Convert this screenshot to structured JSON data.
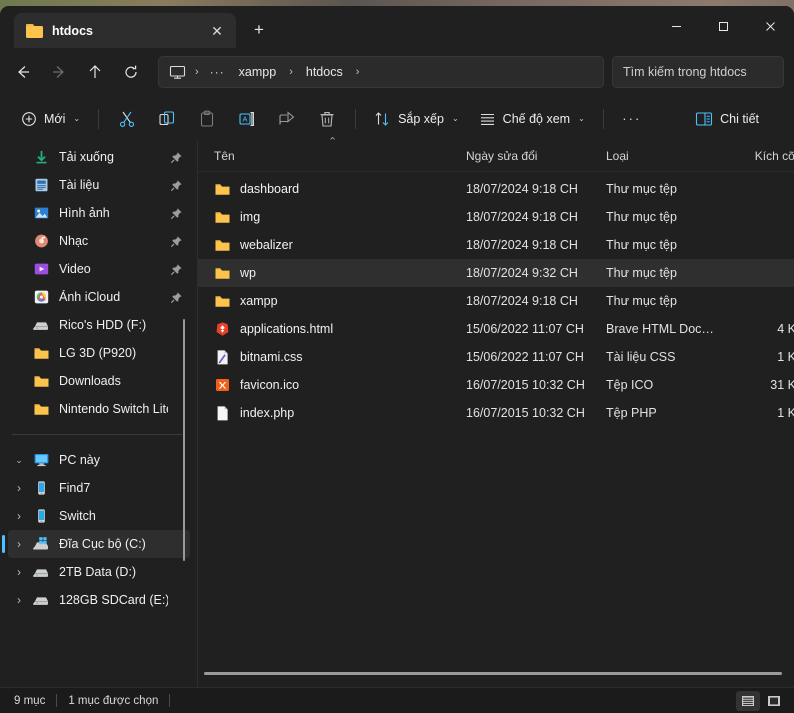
{
  "window": {
    "tab_title": "htdocs",
    "close_tab_label": "✕",
    "new_tab_label": "+",
    "minimize_label": "—",
    "maximize_label": "◻",
    "close_label": "✕"
  },
  "nav": {
    "back_label": "←",
    "forward_label": "→",
    "up_label": "↑",
    "refresh_label": "⟳",
    "breadcrumb": [
      {
        "label": "xampp"
      },
      {
        "label": "htdocs"
      }
    ],
    "breadcrumb_overflow": "···",
    "separator": "›",
    "search_placeholder": "Tìm kiếm trong htdocs"
  },
  "toolbar": {
    "new_label": "Mới",
    "cut_label": "Cắt",
    "copy_label": "Sao chép",
    "paste_label": "Dán",
    "rename_label": "Đổi tên",
    "share_label": "Chia sẻ",
    "delete_label": "Xóa",
    "sort_label": "Sắp xếp",
    "view_label": "Chế độ xem",
    "more_label": "···",
    "details_label": "Chi tiết",
    "chevron": "⌄",
    "accent_color": "#4cc2ff"
  },
  "sidebar": {
    "groups": [
      {
        "items": [
          {
            "label": "Tải xuống",
            "icon": "download-icon",
            "pinned": true,
            "expander": false,
            "selected": false
          },
          {
            "label": "Tài liệu",
            "icon": "documents-icon",
            "pinned": true,
            "expander": false,
            "selected": false
          },
          {
            "label": "Hình ảnh",
            "icon": "pictures-icon",
            "pinned": true,
            "expander": false,
            "selected": false
          },
          {
            "label": "Nhạc",
            "icon": "music-icon",
            "pinned": true,
            "expander": false,
            "selected": false
          },
          {
            "label": "Video",
            "icon": "video-icon",
            "pinned": true,
            "expander": false,
            "selected": false
          },
          {
            "label": "Ảnh iCloud",
            "icon": "icloud-photos-icon",
            "pinned": true,
            "expander": false,
            "selected": false
          },
          {
            "label": "Rico's HDD (F:)",
            "icon": "drive-icon",
            "pinned": false,
            "expander": false,
            "selected": false
          },
          {
            "label": "LG 3D (P920)",
            "icon": "folder-icon",
            "pinned": false,
            "expander": false,
            "selected": false
          },
          {
            "label": "Downloads",
            "icon": "folder-icon",
            "pinned": false,
            "expander": false,
            "selected": false
          },
          {
            "label": "Nintendo Switch Lite b",
            "icon": "folder-icon",
            "pinned": false,
            "expander": false,
            "selected": false
          }
        ]
      },
      {
        "items": [
          {
            "label": "PC này",
            "icon": "this-pc-icon",
            "pinned": false,
            "expander": true,
            "expanded": true,
            "selected": false
          },
          {
            "label": "Find7",
            "icon": "phone-icon",
            "pinned": false,
            "expander": true,
            "expanded": false,
            "selected": false
          },
          {
            "label": "Switch",
            "icon": "phone-icon",
            "pinned": false,
            "expander": true,
            "expanded": false,
            "selected": false
          },
          {
            "label": "Đĩa Cục bộ (C:)",
            "icon": "windows-drive-icon",
            "pinned": false,
            "expander": true,
            "expanded": false,
            "selected": true
          },
          {
            "label": "2TB Data (D:)",
            "icon": "drive-icon",
            "pinned": false,
            "expander": true,
            "expanded": false,
            "selected": false
          },
          {
            "label": "128GB SDCard (E:)",
            "icon": "drive-icon",
            "pinned": false,
            "expander": true,
            "expanded": false,
            "selected": false
          }
        ]
      }
    ]
  },
  "filelist": {
    "columns": {
      "name": "Tên",
      "date": "Ngày sửa đổi",
      "type": "Loại",
      "size": "Kích cỡ"
    },
    "sort_indicator": "⌃",
    "rows": [
      {
        "name": "dashboard",
        "date": "18/07/2024 9:18 CH",
        "type": "Thư mục tệp",
        "size": "",
        "icon": "folder-icon",
        "selected": false
      },
      {
        "name": "img",
        "date": "18/07/2024 9:18 CH",
        "type": "Thư mục tệp",
        "size": "",
        "icon": "folder-icon",
        "selected": false
      },
      {
        "name": "webalizer",
        "date": "18/07/2024 9:18 CH",
        "type": "Thư mục tệp",
        "size": "",
        "icon": "folder-icon",
        "selected": false
      },
      {
        "name": "wp",
        "date": "18/07/2024 9:32 CH",
        "type": "Thư mục tệp",
        "size": "",
        "icon": "folder-icon",
        "selected": true
      },
      {
        "name": "xampp",
        "date": "18/07/2024 9:18 CH",
        "type": "Thư mục tệp",
        "size": "",
        "icon": "folder-icon",
        "selected": false
      },
      {
        "name": "applications.html",
        "date": "15/06/2022 11:07 CH",
        "type": "Brave HTML Docu...",
        "size": "4 K",
        "icon": "brave-icon",
        "selected": false
      },
      {
        "name": "bitnami.css",
        "date": "15/06/2022 11:07 CH",
        "type": "Tài liệu CSS",
        "size": "1 K",
        "icon": "css-file-icon",
        "selected": false
      },
      {
        "name": "favicon.ico",
        "date": "16/07/2015 10:32 CH",
        "type": "Tệp ICO",
        "size": "31 K",
        "icon": "ico-file-icon",
        "selected": false
      },
      {
        "name": "index.php",
        "date": "16/07/2015 10:32 CH",
        "type": "Tệp PHP",
        "size": "1 K",
        "icon": "php-file-icon",
        "selected": false
      }
    ]
  },
  "statusbar": {
    "item_count": "9 mục",
    "selected_count": "1 mục được chọn",
    "view_details_label": "Chế độ xem chi tiết",
    "view_large_label": "Chế độ xem biểu tượng lớn"
  }
}
